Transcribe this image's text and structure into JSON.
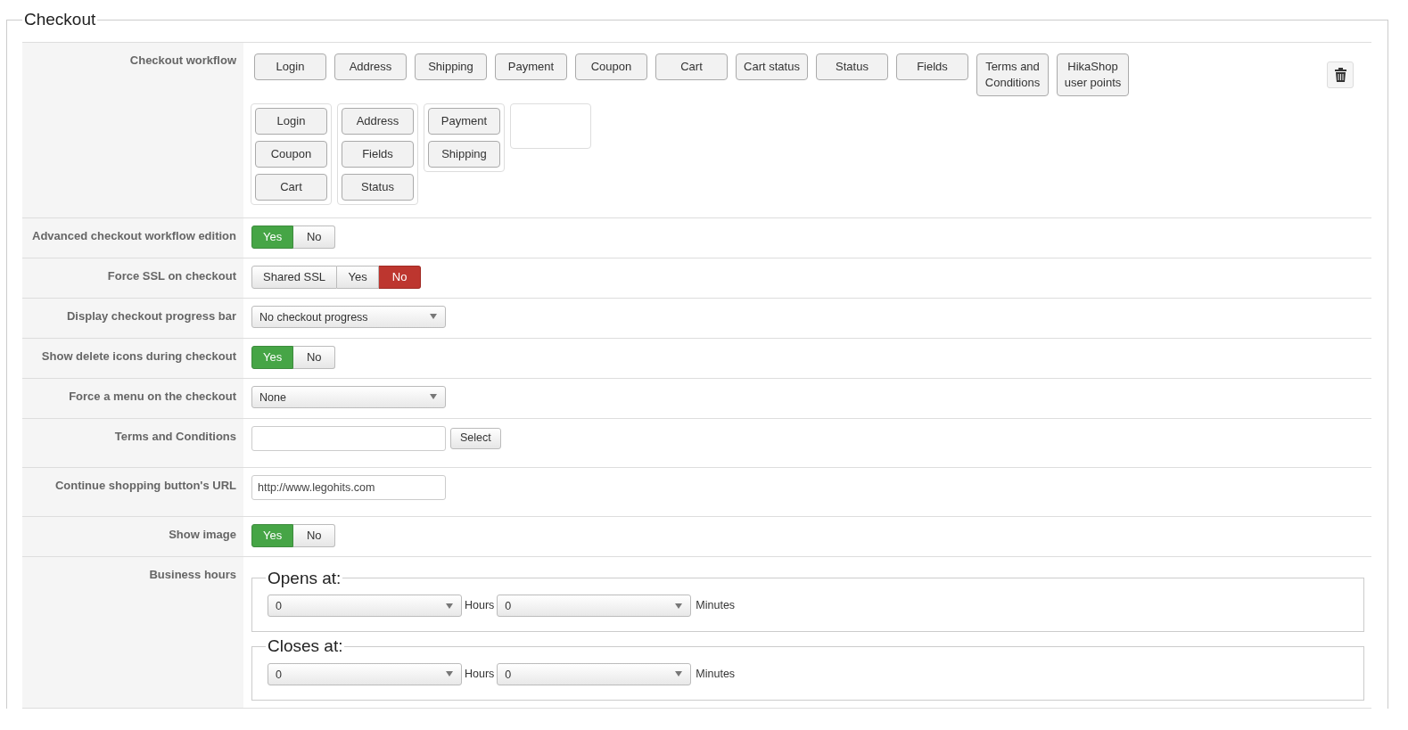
{
  "legend": "Checkout",
  "rows": [
    {
      "kind": "workflow",
      "label": "Checkout workflow",
      "available": [
        "Login",
        "Address",
        "Shipping",
        "Payment",
        "Coupon",
        "Cart",
        "Cart status",
        "Status",
        "Fields",
        "Terms and Conditions",
        "HikaShop user points"
      ],
      "groups": [
        [
          "Login",
          "Coupon",
          "Cart"
        ],
        [
          "Address",
          "Fields",
          "Status"
        ],
        [
          "Payment",
          "Shipping"
        ]
      ]
    },
    {
      "kind": "toggle",
      "label": "Advanced checkout workflow edition",
      "options": [
        {
          "label": "Yes",
          "kind": "yes",
          "selected": true
        },
        {
          "label": "No",
          "kind": "no",
          "selected": false
        }
      ]
    },
    {
      "kind": "toggle",
      "label": "Force SSL on checkout",
      "options": [
        {
          "label": "Shared SSL",
          "kind": "neutral",
          "selected": false
        },
        {
          "label": "Yes",
          "kind": "yes",
          "selected": false
        },
        {
          "label": "No",
          "kind": "no",
          "selected": true
        }
      ]
    },
    {
      "kind": "select",
      "label": "Display checkout progress bar",
      "value": "No checkout progress"
    },
    {
      "kind": "toggle",
      "label": "Show delete icons during checkout",
      "options": [
        {
          "label": "Yes",
          "kind": "yes",
          "selected": true
        },
        {
          "label": "No",
          "kind": "no",
          "selected": false
        }
      ]
    },
    {
      "kind": "select",
      "label": "Force a menu on the checkout",
      "value": "None"
    },
    {
      "kind": "picker",
      "label": "Terms and Conditions",
      "button": "Select"
    },
    {
      "kind": "text",
      "label": "Continue shopping button's URL",
      "value": "http://www.legohits.com"
    },
    {
      "kind": "toggle",
      "label": "Show image",
      "options": [
        {
          "label": "Yes",
          "kind": "yes",
          "selected": true
        },
        {
          "label": "No",
          "kind": "no",
          "selected": false
        }
      ]
    },
    {
      "kind": "hours",
      "label": "Business hours",
      "sets": [
        {
          "legend": "Opens at:",
          "hours": "0",
          "hours_unit": "Hours",
          "minutes": "0",
          "minutes_unit": "Minutes"
        },
        {
          "legend": "Closes at:",
          "hours": "0",
          "hours_unit": "Hours",
          "minutes": "0",
          "minutes_unit": "Minutes"
        }
      ]
    }
  ]
}
